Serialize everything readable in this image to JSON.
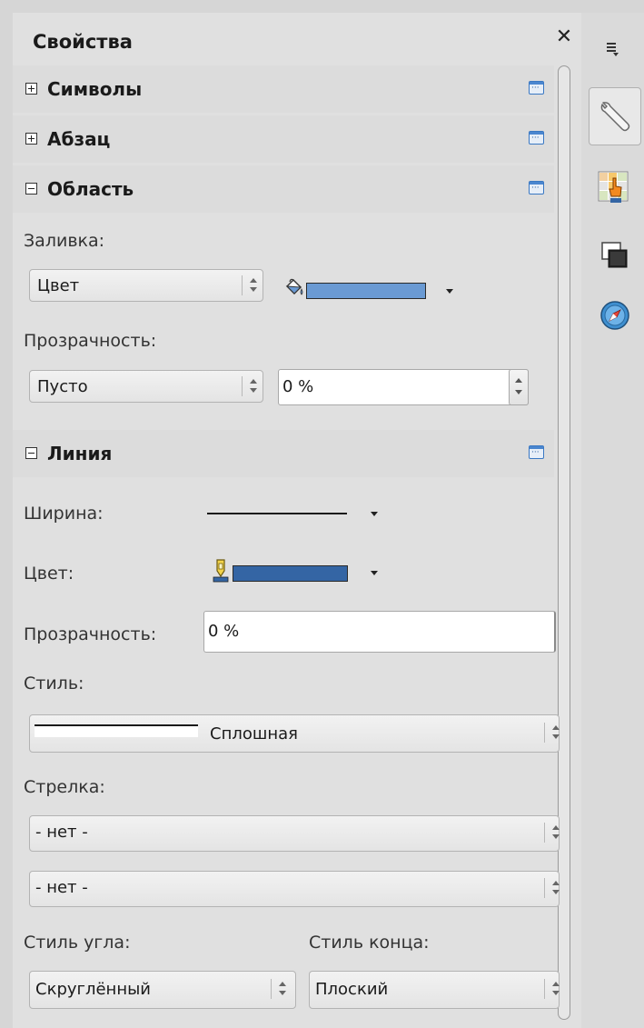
{
  "panel": {
    "title": "Свойства",
    "close_glyph": "✕"
  },
  "sections": {
    "symbols": {
      "title": "Символы",
      "expanded": false
    },
    "paragraph": {
      "title": "Абзац",
      "expanded": false
    },
    "area": {
      "title": "Область",
      "expanded": true,
      "fill_label": "Заливка:",
      "fill_type": "Цвет",
      "fill_color": "#6a9ad3",
      "transparency_label": "Прозрачность:",
      "transparency_type": "Пусто",
      "transparency_value": "0 %"
    },
    "line": {
      "title": "Линия",
      "expanded": true,
      "width_label": "Ширина:",
      "color_label": "Цвет:",
      "color": "#3465a4",
      "transparency_label": "Прозрачность:",
      "transparency_value": "0 %",
      "style_label": "Стиль:",
      "style_value": "Сплошная",
      "arrow_label": "Стрелка:",
      "arrow_start": "- нет -",
      "arrow_end": "- нет -",
      "corner_label": "Стиль угла:",
      "corner_value": "Скруглённый",
      "cap_label": "Стиль конца:",
      "cap_value": "Плоский"
    }
  },
  "sidebar_tabs": [
    {
      "icon": "properties-wrench-icon",
      "active": true
    },
    {
      "icon": "styles-icon",
      "active": false
    },
    {
      "icon": "gallery-icon",
      "active": false
    },
    {
      "icon": "navigator-icon",
      "active": false
    }
  ],
  "colors": {
    "accent": "#3a78c3",
    "panel_bg": "#e0e0e0",
    "header_bg": "#dcdcdc"
  }
}
